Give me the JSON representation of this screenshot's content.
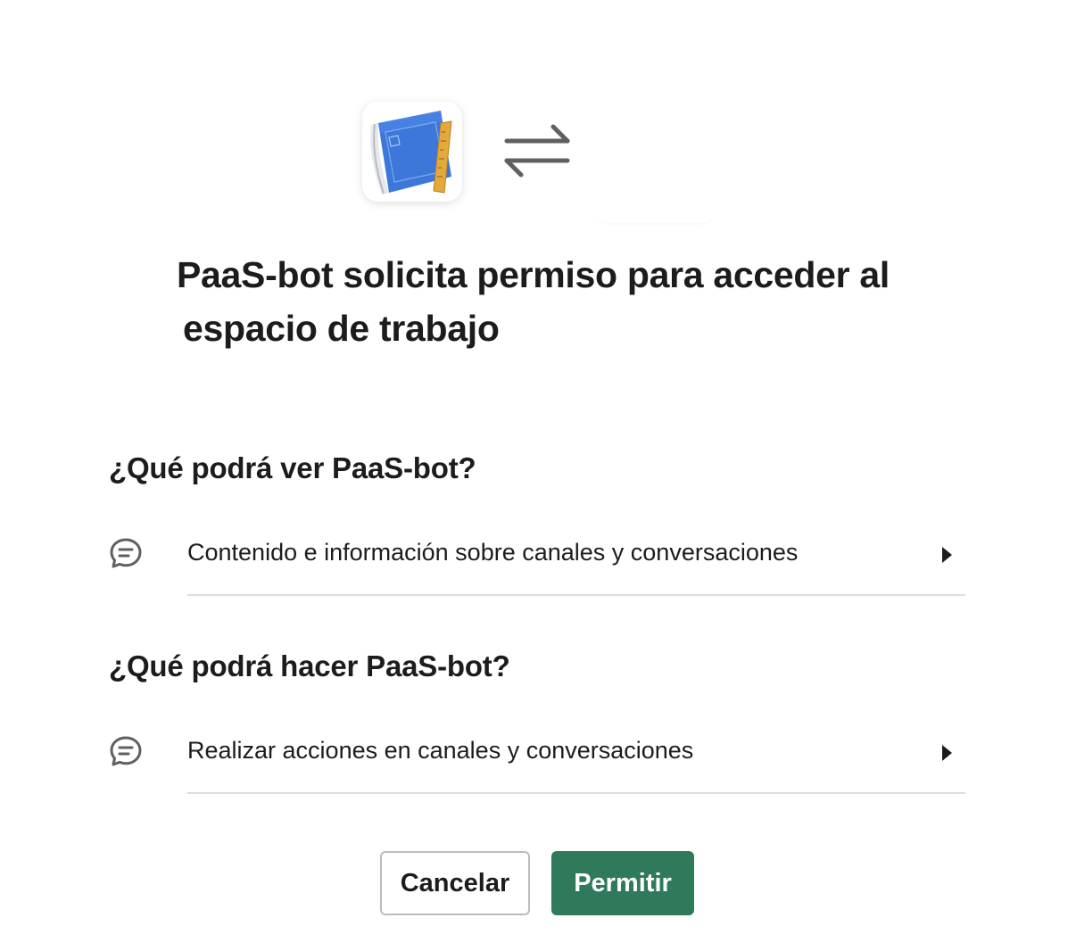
{
  "header": {
    "title_line1": "PaaS-bot solicita permiso para acceder al",
    "title_line2": "espacio de trabajo",
    "app_icon": "blueprint-book-icon",
    "connector_icon": "swap-arrows-icon"
  },
  "sections": [
    {
      "heading": "¿Qué podrá ver PaaS-bot?",
      "items": [
        {
          "icon": "chat-bubble-icon",
          "label": "Contenido e información sobre canales y conversaciones"
        }
      ]
    },
    {
      "heading": "¿Qué podrá hacer PaaS-bot?",
      "items": [
        {
          "icon": "chat-bubble-icon",
          "label": "Realizar acciones en canales y conversaciones"
        }
      ]
    }
  ],
  "actions": {
    "cancel_label": "Cancelar",
    "allow_label": "Permitir"
  },
  "colors": {
    "primary": "#2e7a5a",
    "text": "#1d1c1d",
    "icon_gray": "#616061",
    "divider": "#dedede"
  }
}
